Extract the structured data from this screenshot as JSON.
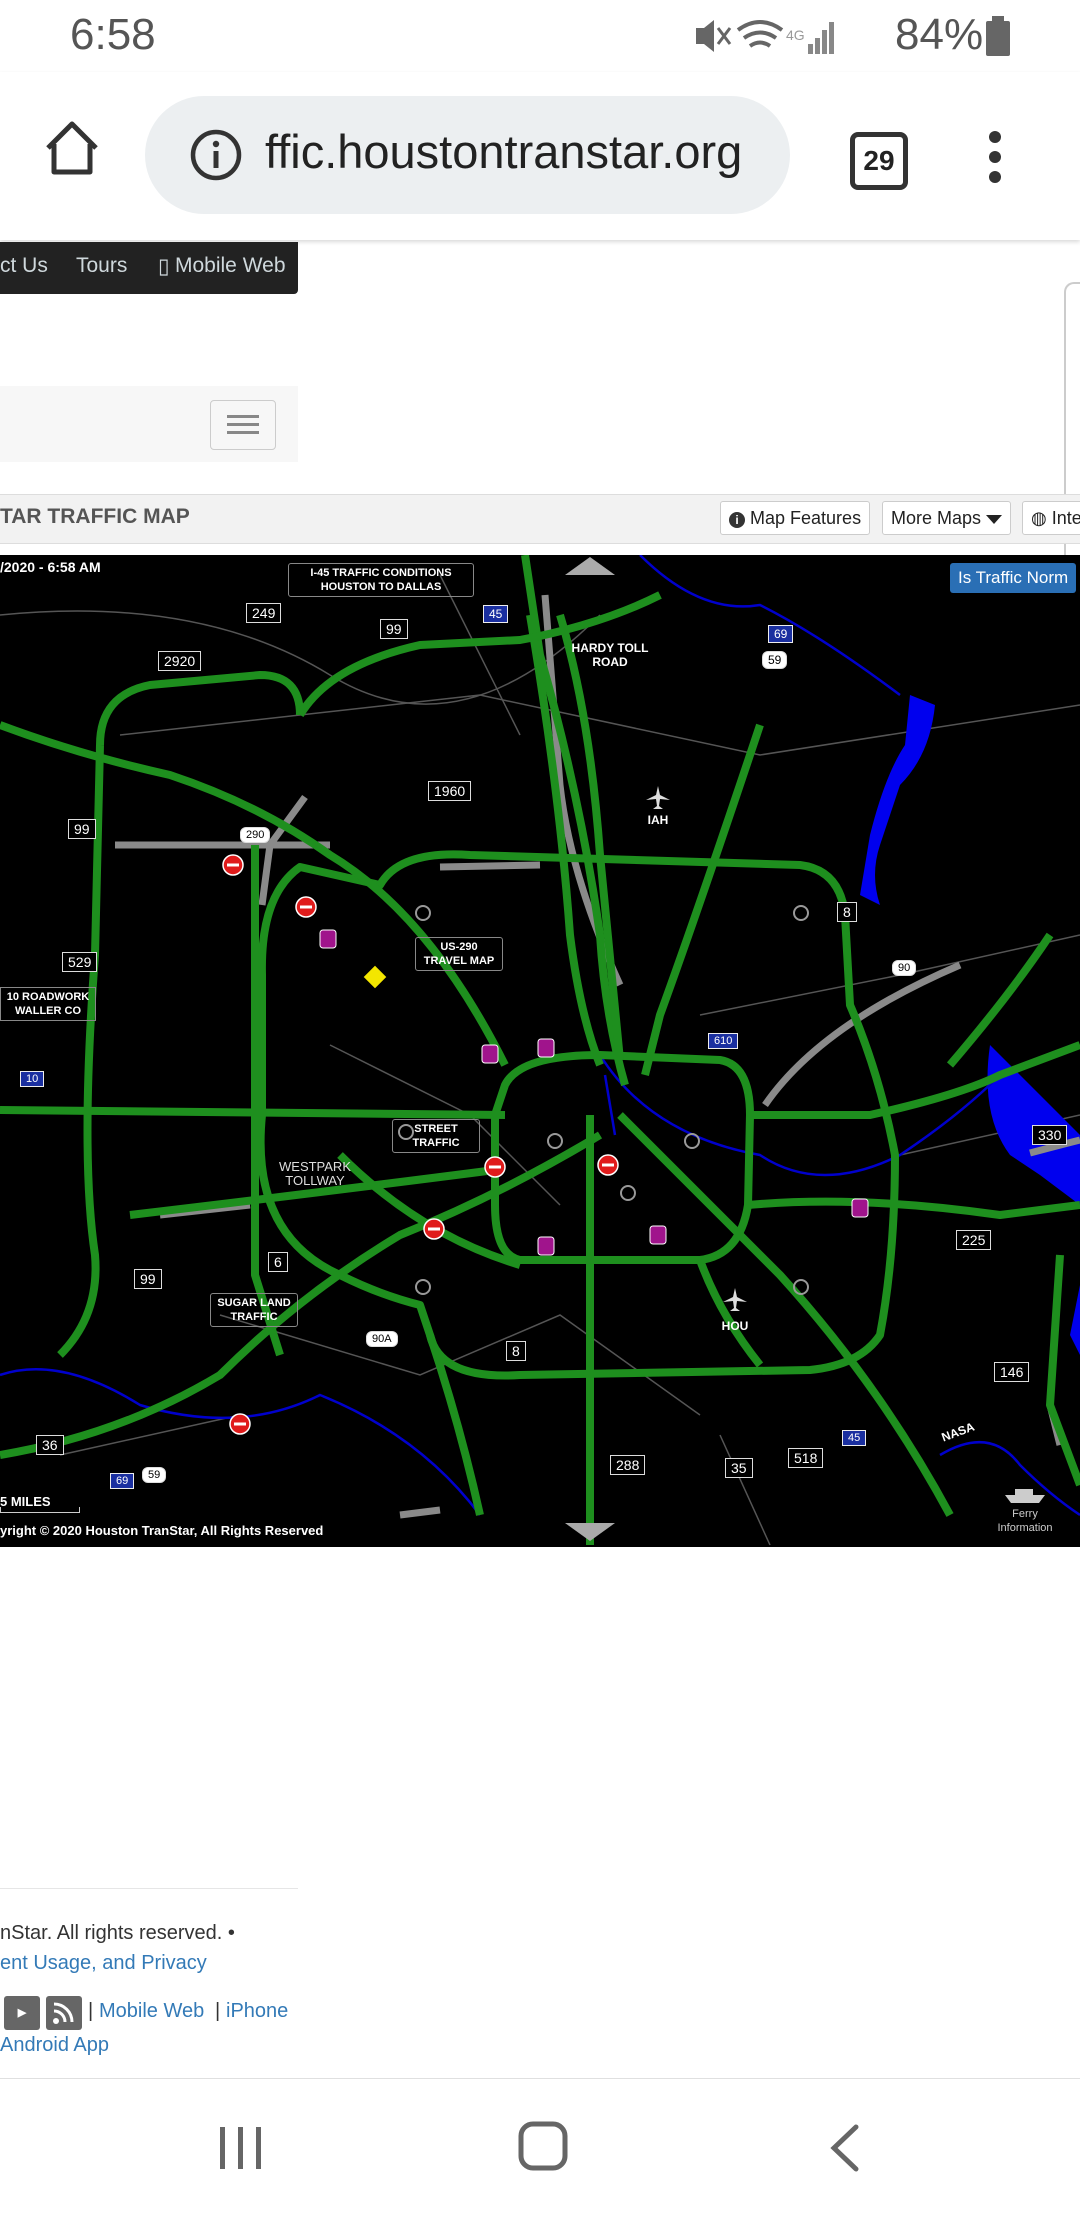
{
  "status_bar": {
    "time": "6:58",
    "network": "4G",
    "battery": "84%"
  },
  "browser": {
    "url": "ffic.houstontranstar.org",
    "tab_count": "29"
  },
  "top_nav": {
    "contact": "ct Us",
    "tours": "Tours",
    "mobile_web": "Mobile Web"
  },
  "map_section": {
    "title": "TAR TRAFFIC MAP",
    "map_features_btn": "Map Features",
    "more_maps_btn": "More Maps",
    "interactive_btn": "Inte",
    "is_traffic_normal_btn": "Is Traffic Norm",
    "timestamp": "/2020 - 6:58 AM",
    "scale": "5 MILES",
    "copyright": "yright © 2020 Houston TranStar, All Rights Reserved"
  },
  "map_labels": {
    "i45_conditions": "I-45 TRAFFIC CONDITIONS HOUSTON TO DALLAS",
    "hardy": "HARDY TOLL ROAD",
    "iah": "IAH",
    "us290_map": "US-290 TRAVEL MAP",
    "roadwork": "10 ROADWORK WALLER CO",
    "street_traffic": "STREET TRAFFIC",
    "westpark": "WESTPARK TOLLWAY",
    "sugarland": "SUGAR LAND TRAFFIC",
    "hou": "HOU",
    "nasa": "NASA",
    "ferry": "Ferry Information"
  },
  "road_shields": {
    "s249": "249",
    "s99a": "99",
    "s2920": "2920",
    "s45a": "45",
    "s69a": "69",
    "s59a": "59",
    "s1960": "1960",
    "s99b": "99",
    "s290": "290",
    "s529": "529",
    "s8a": "8",
    "s90": "90",
    "s610": "610",
    "s10": "10",
    "s330": "330",
    "s225": "225",
    "s6": "6",
    "s99c": "99",
    "s90a": "90A",
    "s8b": "8",
    "s146": "146",
    "s36": "36",
    "s288": "288",
    "s35": "35",
    "s518": "518",
    "s45b": "45",
    "s69b": "69",
    "s59b": "59"
  },
  "footer": {
    "line1": "nStar. All rights reserved. •",
    "line2": "ent Usage, and Privacy",
    "mobile_web": "Mobile Web",
    "iphone": "iPhone",
    "android": "Android App",
    "sep": "|"
  },
  "colors": {
    "road_flow": "#1e8f1e",
    "road_slow": "#8a8a8a",
    "water": "#0000ee",
    "incident_red": "#e01b1b",
    "incident_purple": "#a0148c",
    "link_blue": "#337ab7",
    "traffic_btn": "#2a6fb5"
  }
}
